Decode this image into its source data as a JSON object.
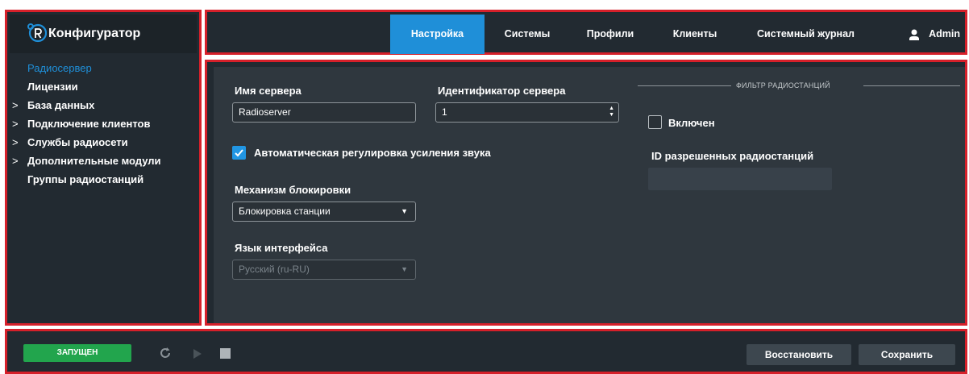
{
  "app": {
    "title": "Конфигуратор"
  },
  "sidebar": {
    "items": [
      {
        "label": "Радиосервер",
        "arrow": ""
      },
      {
        "label": "Лицензии",
        "arrow": ""
      },
      {
        "label": "База данных",
        "arrow": ">"
      },
      {
        "label": "Подключение клиентов",
        "arrow": ">"
      },
      {
        "label": "Службы радиосети",
        "arrow": ">"
      },
      {
        "label": "Дополнительные модули",
        "arrow": ">"
      },
      {
        "label": "Группы радиостанций",
        "arrow": ""
      }
    ]
  },
  "topnav": {
    "tabs": [
      {
        "label": "Настройка"
      },
      {
        "label": "Системы"
      },
      {
        "label": "Профили"
      },
      {
        "label": "Клиенты"
      },
      {
        "label": "Системный журнал"
      }
    ],
    "user": "Admin"
  },
  "form": {
    "server_name_label": "Имя сервера",
    "server_name_value": "Radioserver",
    "server_id_label": "Идентификатор сервера",
    "server_id_value": "1",
    "agc_label": "Автоматическая регулировка усиления звука",
    "agc_checked": true,
    "lock_label": "Механизм блокировки",
    "lock_value": "Блокировка станции",
    "lang_label": "Язык интерфейса",
    "lang_value": "Русский (ru-RU)"
  },
  "filter": {
    "title": "ФИЛЬТР РАДИОСТАНЦИЙ",
    "enabled_label": "Включен",
    "enabled_checked": false,
    "ids_label": "ID разрешенных радиостанций"
  },
  "footer": {
    "status": "ЗАПУЩЕН",
    "restore": "Восстановить",
    "save": "Сохранить"
  },
  "colors": {
    "accent": "#1f8fd8",
    "status_running": "#22a54d",
    "frame_highlight": "#d6202a"
  },
  "icons": [
    "logo-icon",
    "user-icon",
    "check-icon",
    "refresh-icon",
    "play-icon",
    "stop-icon",
    "chevron-right-icon",
    "chevron-down-icon",
    "spinner-arrows-icon"
  ]
}
